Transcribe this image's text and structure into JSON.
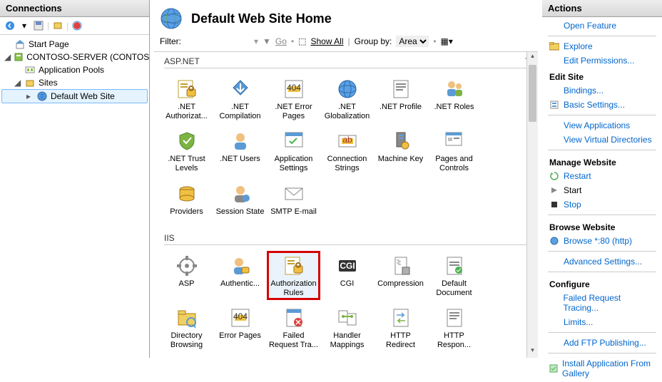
{
  "left": {
    "title": "Connections",
    "tree": {
      "start": "Start Page",
      "server": "CONTOSO-SERVER (CONTOS",
      "apppools": "Application Pools",
      "sites": "Sites",
      "defaultsite": "Default Web Site"
    }
  },
  "center": {
    "title": "Default Web Site Home",
    "filter_label": "Filter:",
    "go": "Go",
    "showall": "Show All",
    "groupby_label": "Group by:",
    "groupby_value": "Area",
    "groups": {
      "aspnet": "ASP.NET",
      "iis": "IIS"
    },
    "features_aspnet": [
      ".NET Authorizat...",
      ".NET Compilation",
      ".NET Error Pages",
      ".NET Globalization",
      ".NET Profile",
      ".NET Roles",
      ".NET Trust Levels",
      ".NET Users",
      "Application Settings",
      "Connection Strings",
      "Machine Key",
      "Pages and Controls",
      "Providers",
      "Session State",
      "SMTP E-mail"
    ],
    "features_iis": [
      "ASP",
      "Authentic...",
      "Authorization Rules",
      "CGI",
      "Compression",
      "Default Document",
      "Directory Browsing",
      "Error Pages",
      "Failed Request Tra...",
      "Handler Mappings",
      "HTTP Redirect",
      "HTTP Respon..."
    ]
  },
  "right": {
    "title": "Actions",
    "openfeature": "Open Feature",
    "explore": "Explore",
    "editperm": "Edit Permissions...",
    "editsite": "Edit Site",
    "bindings": "Bindings...",
    "basicsettings": "Basic Settings...",
    "viewapp": "View Applications",
    "viewvdir": "View Virtual Directories",
    "manage": "Manage Website",
    "restart": "Restart",
    "start": "Start",
    "stop": "Stop",
    "browse_hdr": "Browse Website",
    "browse80": "Browse *:80 (http)",
    "advanced": "Advanced Settings...",
    "configure": "Configure",
    "failedreq": "Failed Request Tracing...",
    "limits": "Limits...",
    "addftp": "Add FTP Publishing...",
    "installgallery": "Install Application From Gallery"
  }
}
